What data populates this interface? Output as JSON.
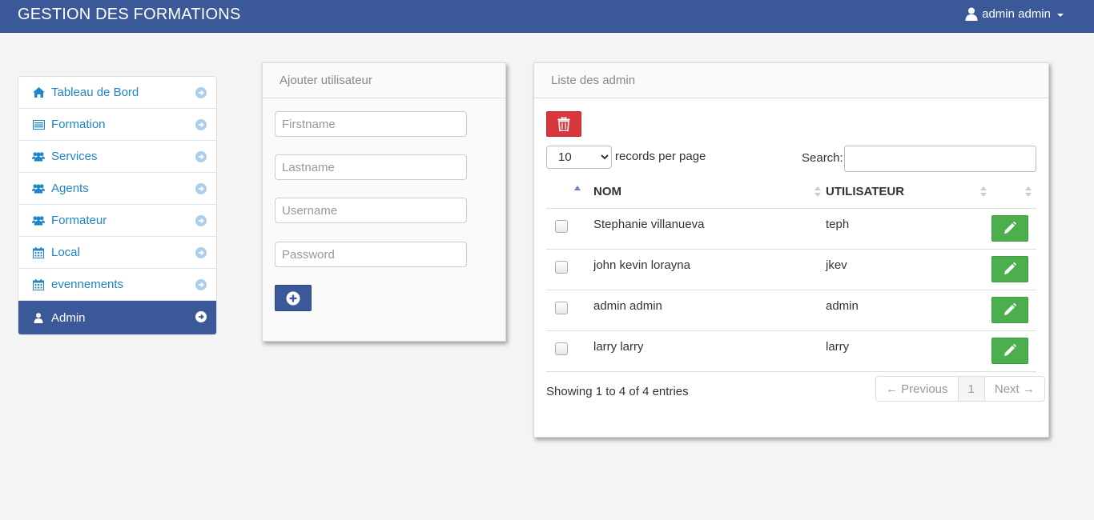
{
  "app": {
    "title": "GESTION DES FORMATIONS",
    "user_label": "admin admin",
    "brand_color": "#3b5998"
  },
  "sidebar": {
    "items": [
      {
        "label": "Tableau de Bord",
        "icon": "home-icon"
      },
      {
        "label": "Formation",
        "icon": "list-icon"
      },
      {
        "label": "Services",
        "icon": "users-icon"
      },
      {
        "label": "Agents",
        "icon": "users-icon"
      },
      {
        "label": "Formateur",
        "icon": "users-icon"
      },
      {
        "label": "Local",
        "icon": "calendar-icon"
      },
      {
        "label": "evennements",
        "icon": "calendar-icon"
      },
      {
        "label": "Admin",
        "icon": "user-icon",
        "active": true
      }
    ]
  },
  "add_panel": {
    "title": "Ajouter utilisateur",
    "firstname_placeholder": "Firstname",
    "lastname_placeholder": "Lastname",
    "username_placeholder": "Username",
    "password_placeholder": "Password"
  },
  "list_panel": {
    "title": "Liste des admin",
    "per_page_value": "10",
    "per_page_label": "records per page",
    "search_label": "Search:",
    "columns": [
      "NOM",
      "UTILISATEUR"
    ],
    "rows": [
      {
        "nom": "Stephanie villanueva",
        "utilisateur": "teph"
      },
      {
        "nom": "john kevin lorayna",
        "utilisateur": "jkev"
      },
      {
        "nom": "admin admin",
        "utilisateur": "admin"
      },
      {
        "nom": "larry larry",
        "utilisateur": "larry"
      }
    ],
    "info": "Showing 1 to 4 of 4 entries",
    "pager": {
      "previous": "← Previous",
      "page": "1",
      "next": "Next →"
    }
  }
}
